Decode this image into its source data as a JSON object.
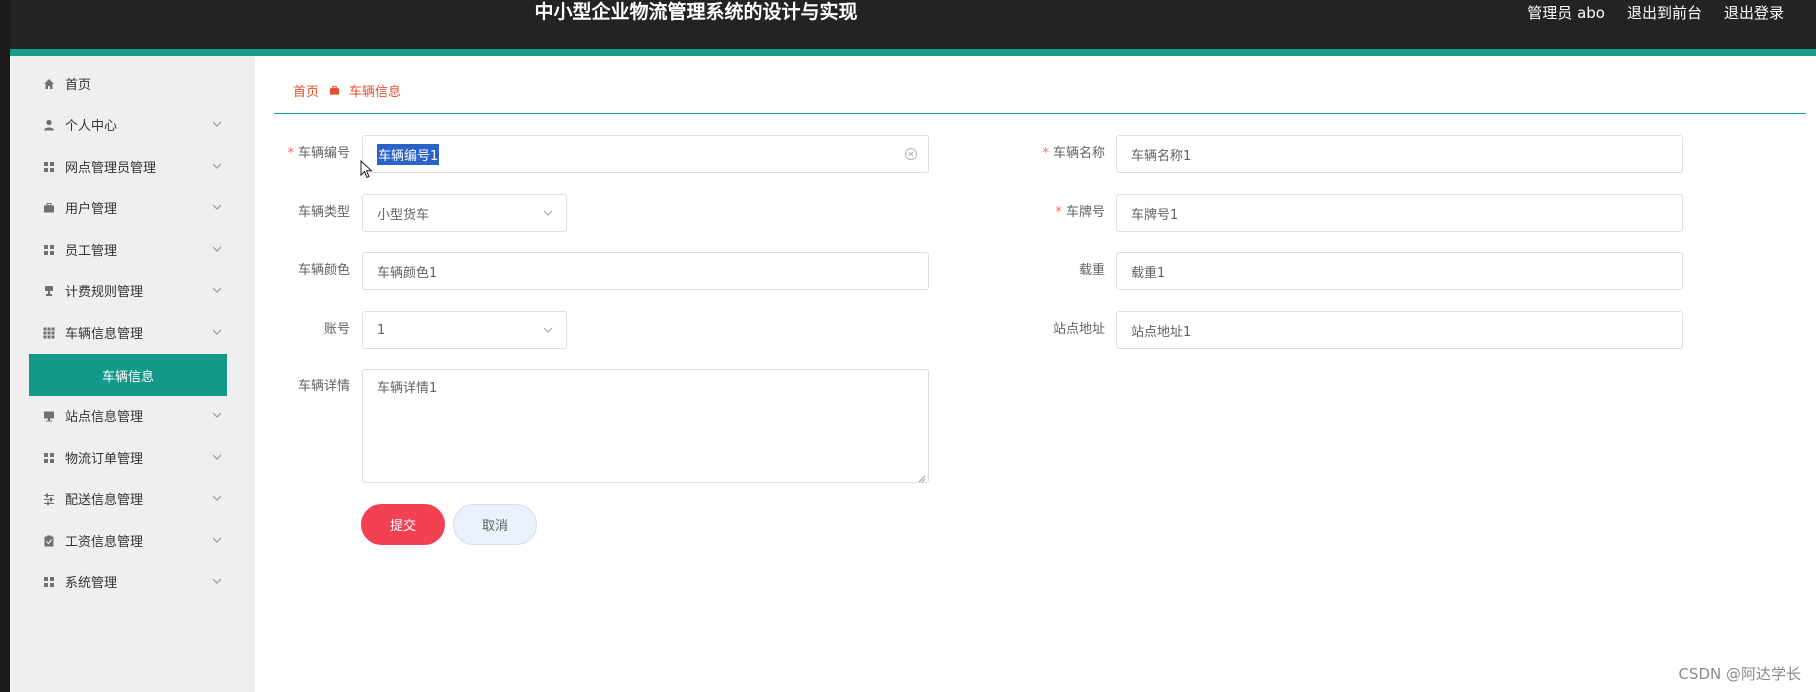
{
  "app": {
    "title": "中小型企业物流管理系统的设计与实现",
    "user_label": "管理员 abo",
    "back_to_front": "退出到前台",
    "logout": "退出登录"
  },
  "colors": {
    "header_bg": "#232323",
    "accent": "#1a9e8c",
    "active_menu": "#12998a",
    "breadcrumb": "#e84f2e",
    "submit": "#f24152",
    "required": "#f56c6c"
  },
  "sidebar": {
    "items": [
      {
        "label": "首页",
        "icon": "home-icon",
        "has_children": false
      },
      {
        "label": "个人中心",
        "icon": "user-icon",
        "has_children": true
      },
      {
        "label": "网点管理员管理",
        "icon": "grid-icon",
        "has_children": true
      },
      {
        "label": "用户管理",
        "icon": "briefcase-icon",
        "has_children": true
      },
      {
        "label": "员工管理",
        "icon": "grid-icon",
        "has_children": true
      },
      {
        "label": "计费规则管理",
        "icon": "stamp-icon",
        "has_children": true
      },
      {
        "label": "车辆信息管理",
        "icon": "apps-icon",
        "has_children": true
      },
      {
        "label": "站点信息管理",
        "icon": "monitor-icon",
        "has_children": true
      },
      {
        "label": "物流订单管理",
        "icon": "grid-icon",
        "has_children": true
      },
      {
        "label": "配送信息管理",
        "icon": "sliders-icon",
        "has_children": true
      },
      {
        "label": "工资信息管理",
        "icon": "clipboard-icon",
        "has_children": true
      },
      {
        "label": "系统管理",
        "icon": "grid-icon",
        "has_children": true
      }
    ],
    "active_sub": "车辆信息"
  },
  "breadcrumb": {
    "home": "首页",
    "current": "车辆信息"
  },
  "form": {
    "vehicle_no": {
      "label": "车辆编号",
      "value": "车辆编号1",
      "required": true
    },
    "vehicle_name": {
      "label": "车辆名称",
      "value": "车辆名称1",
      "required": true
    },
    "vehicle_type": {
      "label": "车辆类型",
      "value": "小型货车",
      "required": false
    },
    "plate_no": {
      "label": "车牌号",
      "value": "车牌号1",
      "required": true
    },
    "vehicle_color": {
      "label": "车辆颜色",
      "value": "车辆颜色1",
      "required": false
    },
    "load": {
      "label": "载重",
      "value": "载重1",
      "required": false
    },
    "account": {
      "label": "账号",
      "value": "1",
      "required": false
    },
    "station_address": {
      "label": "站点地址",
      "value": "站点地址1",
      "required": false
    },
    "details": {
      "label": "车辆详情",
      "value": "车辆详情1",
      "required": false
    },
    "submit_label": "提交",
    "cancel_label": "取消"
  },
  "watermark": "CSDN @阿达学长"
}
